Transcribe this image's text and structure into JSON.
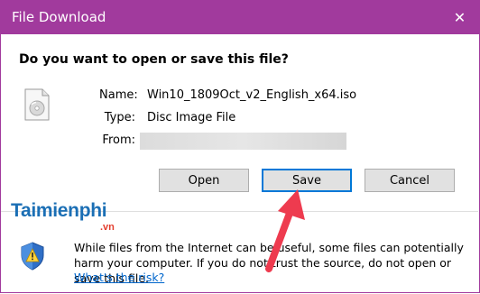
{
  "window": {
    "title": "File Download",
    "close_glyph": "✕",
    "accent_color": "#a13a9d"
  },
  "dialog": {
    "question": "Do you want to open or save this file?",
    "file_icon": "disc-image-file-icon",
    "name_label": "Name:",
    "name_value": "Win10_1809Oct_v2_English_x64.iso",
    "type_label": "Type:",
    "type_value": "Disc Image File",
    "from_label": "From:",
    "buttons": {
      "open": "Open",
      "save": "Save",
      "cancel": "Cancel"
    }
  },
  "footer": {
    "shield_icon": "security-shield-icon",
    "warning_text": "While files from the Internet can be useful, some files can potentially harm your computer. If you do not trust the source, do not open or save this file.",
    "risk_link": "What's the risk?"
  },
  "overlay": {
    "watermark_text": "Taimienphi",
    "watermark_suffix": ".vn",
    "arrow_color": "#ee3b4f"
  }
}
